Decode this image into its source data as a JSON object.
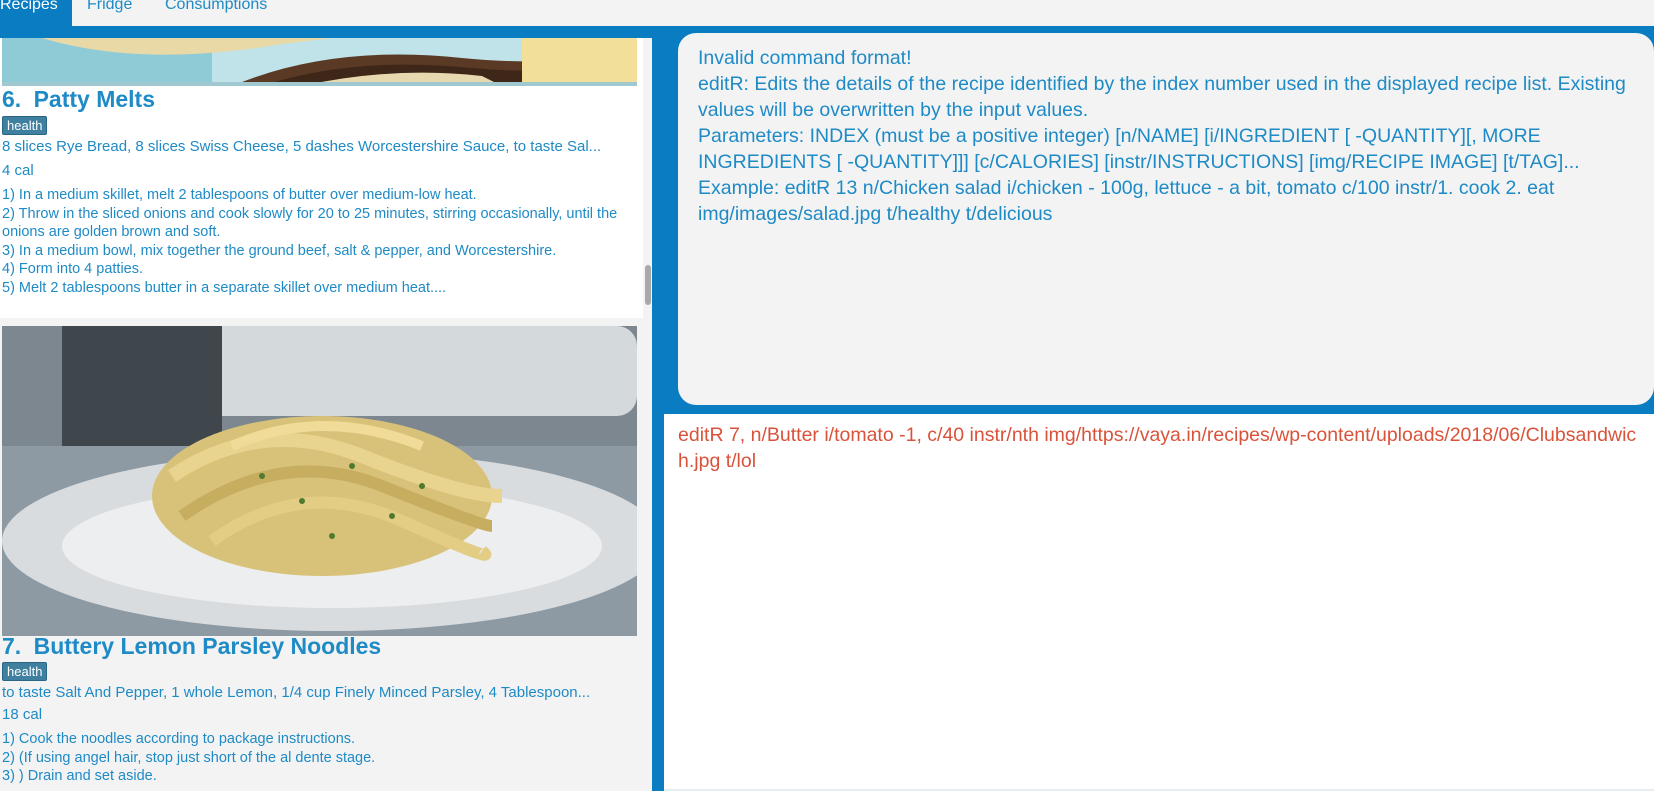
{
  "tabs": [
    {
      "label": "Recipes",
      "active": true
    },
    {
      "label": "Fridge",
      "active": false
    },
    {
      "label": "Consumptions",
      "active": false
    }
  ],
  "recipes": [
    {
      "index": "6.",
      "name": "Patty Melts",
      "tag": "health",
      "ingredients": "8 slices Rye Bread, 8 slices Swiss Cheese, 5 dashes Worcestershire Sauce, to taste Sal...",
      "calories": "4 cal",
      "instructions": [
        "1) In a medium skillet, melt 2 tablespoons of butter over medium-low heat.",
        "2) Throw in the sliced onions and cook slowly for 20 to 25 minutes, stirring occasionally, until the onions are golden brown and soft.",
        "3) In a medium bowl, mix together the ground beef, salt & pepper, and Worcestershire.",
        "4) Form into 4 patties.",
        "5) Melt 2 tablespoons butter in a separate skillet over medium heat...."
      ]
    },
    {
      "index": "7.",
      "name": "Buttery Lemon Parsley Noodles",
      "tag": "health",
      "ingredients": "to taste Salt And Pepper, 1 whole Lemon, 1/4 cup Finely Minced Parsley, 4 Tablespoon...",
      "calories": "18 cal",
      "instructions": [
        "1) Cook the noodles according to package instructions.",
        "2) (If using angel hair, stop just short of the al dente stage.",
        "3) ) Drain and set aside."
      ]
    }
  ],
  "result": {
    "lines": [
      "Invalid command format!",
      "editR: Edits the details of the recipe identified by the index number used in the displayed recipe list. Existing values will be overwritten by the input values.",
      "Parameters: INDEX (must be a positive integer) [n/NAME] [i/INGREDIENT [ -QUANTITY][, MORE INGREDIENTS [ -QUANTITY]]] [c/CALORIES] [instr/INSTRUCTIONS] [img/RECIPE IMAGE] [t/TAG]...",
      "Example: editR 13 n/Chicken salad i/chicken - 100g, lettuce - a bit, tomato c/100 instr/1. cook 2. eat img/images/salad.jpg t/healthy t/delicious"
    ]
  },
  "command": {
    "value": "editR 7, n/Butter i/tomato -1, c/40 instr/nth img/https://vaya.in/recipes/wp-content/uploads/2018/06/Clubsandwich.jpg t/lol"
  },
  "colors": {
    "accent": "#0a7cc2",
    "text": "#1e8ac6",
    "error": "#d9533a",
    "tag": "#3f7f9f"
  }
}
